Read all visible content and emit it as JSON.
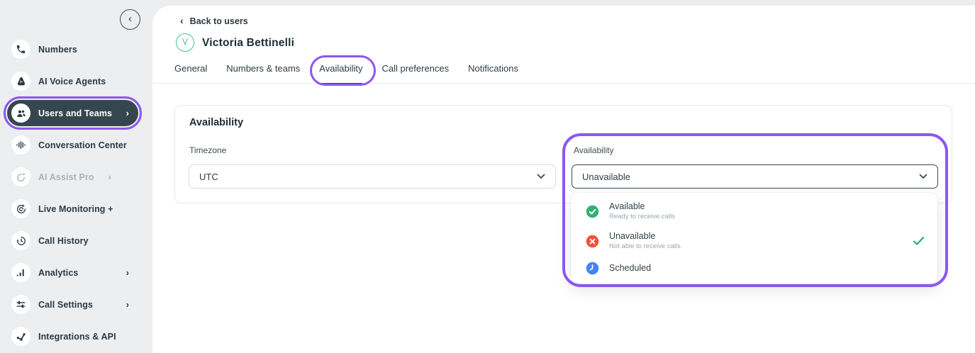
{
  "sidebar": {
    "collapse_glyph": "‹",
    "chevron_glyph": "›",
    "items": [
      {
        "label": "Numbers",
        "icon": "phone-icon"
      },
      {
        "label": "AI Voice Agents",
        "icon": "ai-voice-agents-icon"
      },
      {
        "label": "Users and Teams",
        "icon": "users-icon",
        "selected": true
      },
      {
        "label": "Conversation Center",
        "icon": "waveform-icon"
      },
      {
        "label": "AI Assist Pro",
        "icon": "ai-assist-icon",
        "disabled": true
      },
      {
        "label": "Live Monitoring +",
        "icon": "live-monitoring-icon"
      },
      {
        "label": "Call History",
        "icon": "call-history-icon"
      },
      {
        "label": "Analytics",
        "icon": "analytics-icon"
      },
      {
        "label": "Call Settings",
        "icon": "call-settings-icon"
      },
      {
        "label": "Integrations & API",
        "icon": "integrations-icon"
      }
    ]
  },
  "header": {
    "back_glyph": "‹",
    "back_label": "Back to users",
    "avatar_initial": "V",
    "user_name": "Victoria Bettinelli",
    "tabs": [
      {
        "label": "General"
      },
      {
        "label": "Numbers & teams"
      },
      {
        "label": "Availability"
      },
      {
        "label": "Call preferences"
      },
      {
        "label": "Notifications"
      }
    ],
    "active_tab": "Availability"
  },
  "card": {
    "title": "Availability",
    "timezone_label": "Timezone",
    "timezone_value": "UTC",
    "availability_label": "Availability",
    "availability_value": "Unavailable"
  },
  "availability_dropdown": {
    "options": [
      {
        "label": "Available",
        "description": "Ready to receive calls",
        "icon": "available-check-icon",
        "selected": false
      },
      {
        "label": "Unavailable",
        "description": "Not able to receive calls",
        "icon": "unavailable-x-icon",
        "selected": true
      },
      {
        "label": "Scheduled",
        "description": "",
        "icon": "scheduled-clock-icon",
        "selected": false
      }
    ]
  },
  "colors": {
    "annotation_purple": "#8b57f3",
    "sidebar_active_bg": "#36464e",
    "available_green": "#2fb275",
    "unavailable_red": "#f05138",
    "scheduled_blue": "#4285f2",
    "selected_check_green": "#26b37c",
    "avatar_teal": "#42c29e"
  }
}
